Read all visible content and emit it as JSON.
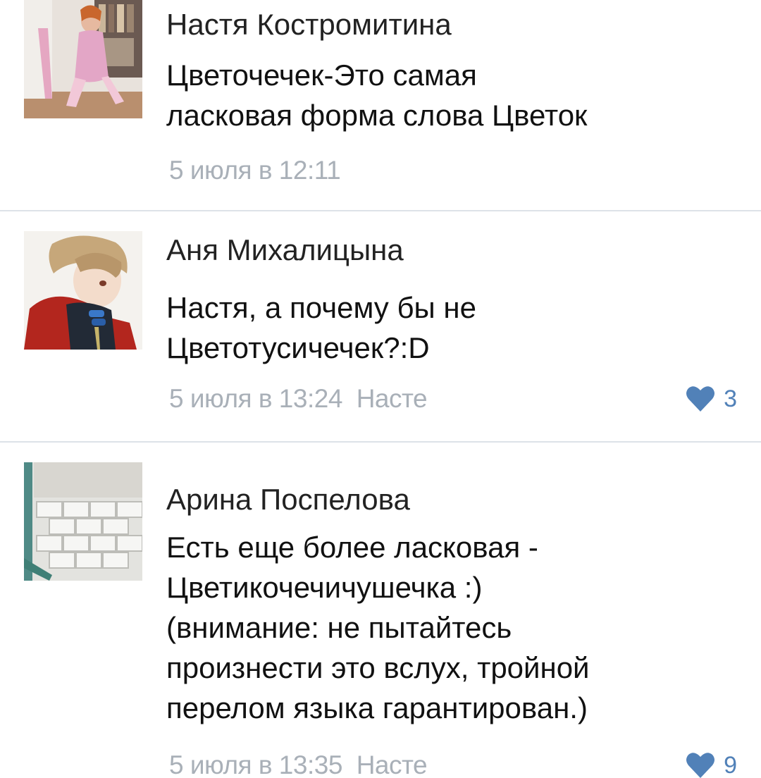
{
  "comments": [
    {
      "author": "Настя Костромитина",
      "text_lines": [
        "Цветочечек-Это самая",
        "ласковая форма слова Цветок"
      ],
      "date": "5 июля в 12:11",
      "reply_to": "",
      "likes": ""
    },
    {
      "author": "Аня Михалицына",
      "text_lines": [
        "Настя, а почему бы не",
        "Цветотусичечек?:D"
      ],
      "date": "5 июля в 13:24",
      "reply_to": "Насте",
      "likes": "3"
    },
    {
      "author": "Арина Поспелова",
      "text_lines": [
        "Есть еще более ласковая -",
        "Цветикочечичушечка :)",
        "(внимание: не пытайтесь",
        "произнести это вслух, тройной",
        "перелом языка гарантирован.)"
      ],
      "date": "5 июля в 13:35",
      "reply_to": "Насте",
      "likes": "9"
    }
  ],
  "colors": {
    "like_accent": "#5181b8",
    "meta_text": "#a9b0b8",
    "divider": "#dde2e8"
  },
  "icons": {
    "like": "heart-icon"
  }
}
